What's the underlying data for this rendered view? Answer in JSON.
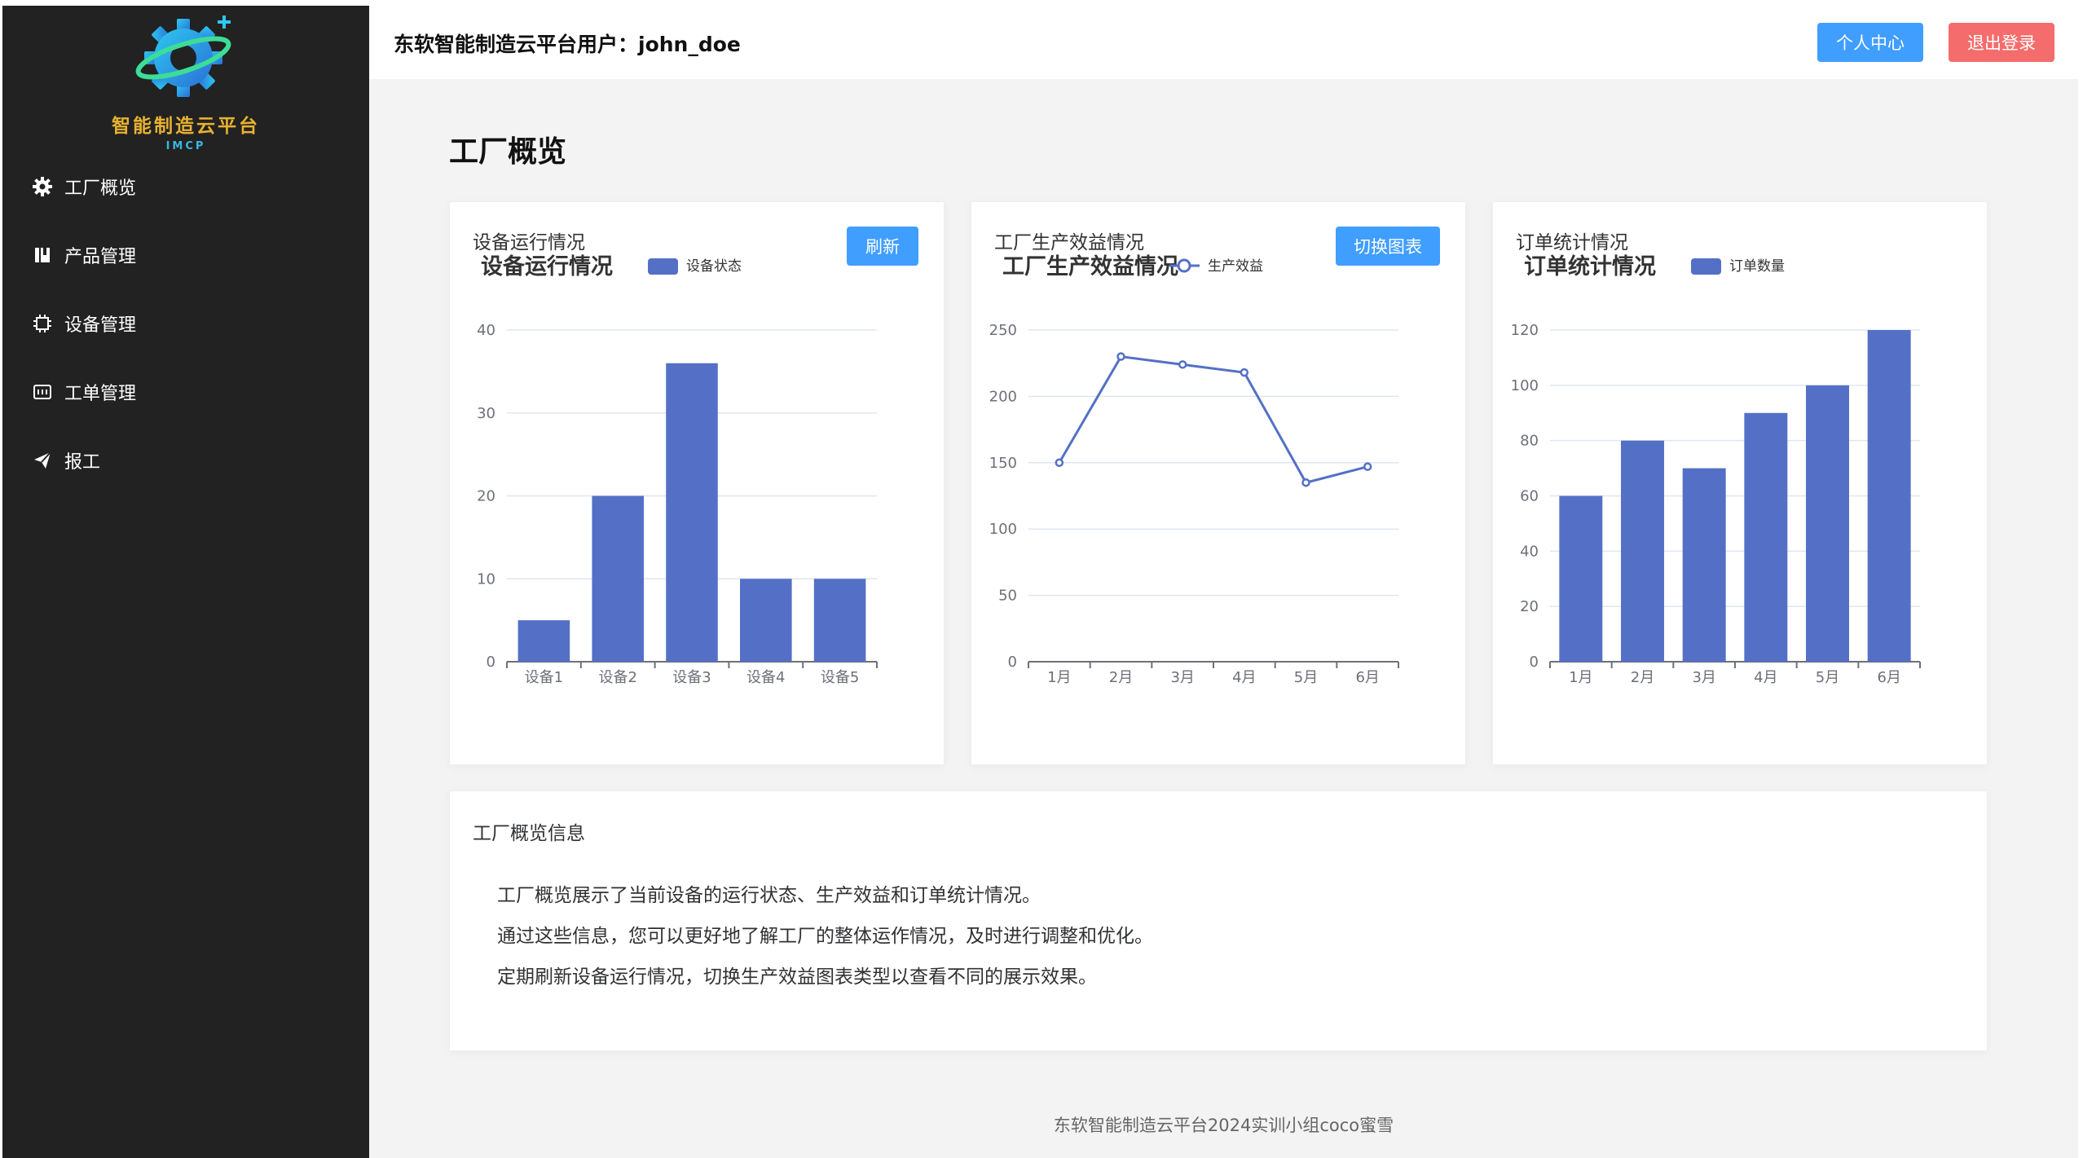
{
  "sidebar": {
    "logo_title": "智能制造云平台",
    "logo_sub": "IMCP",
    "items": [
      {
        "label": "工厂概览",
        "icon": "gear-icon"
      },
      {
        "label": "产品管理",
        "icon": "book-icon"
      },
      {
        "label": "设备管理",
        "icon": "chip-icon"
      },
      {
        "label": "工单管理",
        "icon": "ticket-icon"
      },
      {
        "label": "报工",
        "icon": "send-icon"
      }
    ]
  },
  "header": {
    "user_text": "东软智能制造云平台用户：john_doe",
    "profile_label": "个人中心",
    "logout_label": "退出登录"
  },
  "page": {
    "title": "工厂概览"
  },
  "colors": {
    "bar": "#5470c6",
    "primary": "#409eff",
    "danger": "#f56c6c",
    "sidebar": "#222222"
  },
  "cards": {
    "equipment": {
      "header": "设备运行情况",
      "button": "刷新"
    },
    "production": {
      "header": "工厂生产效益情况",
      "button": "切换图表"
    },
    "orders": {
      "header": "订单统计情况"
    }
  },
  "chart_data": [
    {
      "type": "bar",
      "title": "设备运行情况",
      "categories": [
        "设备1",
        "设备2",
        "设备3",
        "设备4",
        "设备5"
      ],
      "series": [
        {
          "name": "设备状态",
          "values": [
            5,
            20,
            36,
            10,
            10
          ]
        }
      ],
      "ylim": [
        0,
        40
      ],
      "yticks": [
        0,
        10,
        20,
        30,
        40
      ],
      "grid": true,
      "legend": "top"
    },
    {
      "type": "line",
      "title": "工厂生产效益情况",
      "categories": [
        "1月",
        "2月",
        "3月",
        "4月",
        "5月",
        "6月"
      ],
      "series": [
        {
          "name": "生产效益",
          "values": [
            150,
            230,
            224,
            218,
            135,
            147
          ]
        }
      ],
      "ylim": [
        0,
        250
      ],
      "yticks": [
        0,
        50,
        100,
        150,
        200,
        250
      ],
      "grid": true,
      "legend": "top"
    },
    {
      "type": "bar",
      "title": "订单统计情况",
      "categories": [
        "1月",
        "2月",
        "3月",
        "4月",
        "5月",
        "6月"
      ],
      "series": [
        {
          "name": "订单数量",
          "values": [
            60,
            80,
            70,
            90,
            100,
            120
          ]
        }
      ],
      "ylim": [
        0,
        120
      ],
      "yticks": [
        0,
        20,
        40,
        60,
        80,
        100,
        120
      ],
      "grid": true,
      "legend": "top"
    }
  ],
  "info": {
    "title": "工厂概览信息",
    "lines": [
      "工厂概览展示了当前设备的运行状态、生产效益和订单统计情况。",
      "通过这些信息，您可以更好地了解工厂的整体运作情况，及时进行调整和优化。",
      "定期刷新设备运行情况，切换生产效益图表类型以查看不同的展示效果。"
    ]
  },
  "footer": "东软智能制造云平台2024实训小组coco蜜雪"
}
